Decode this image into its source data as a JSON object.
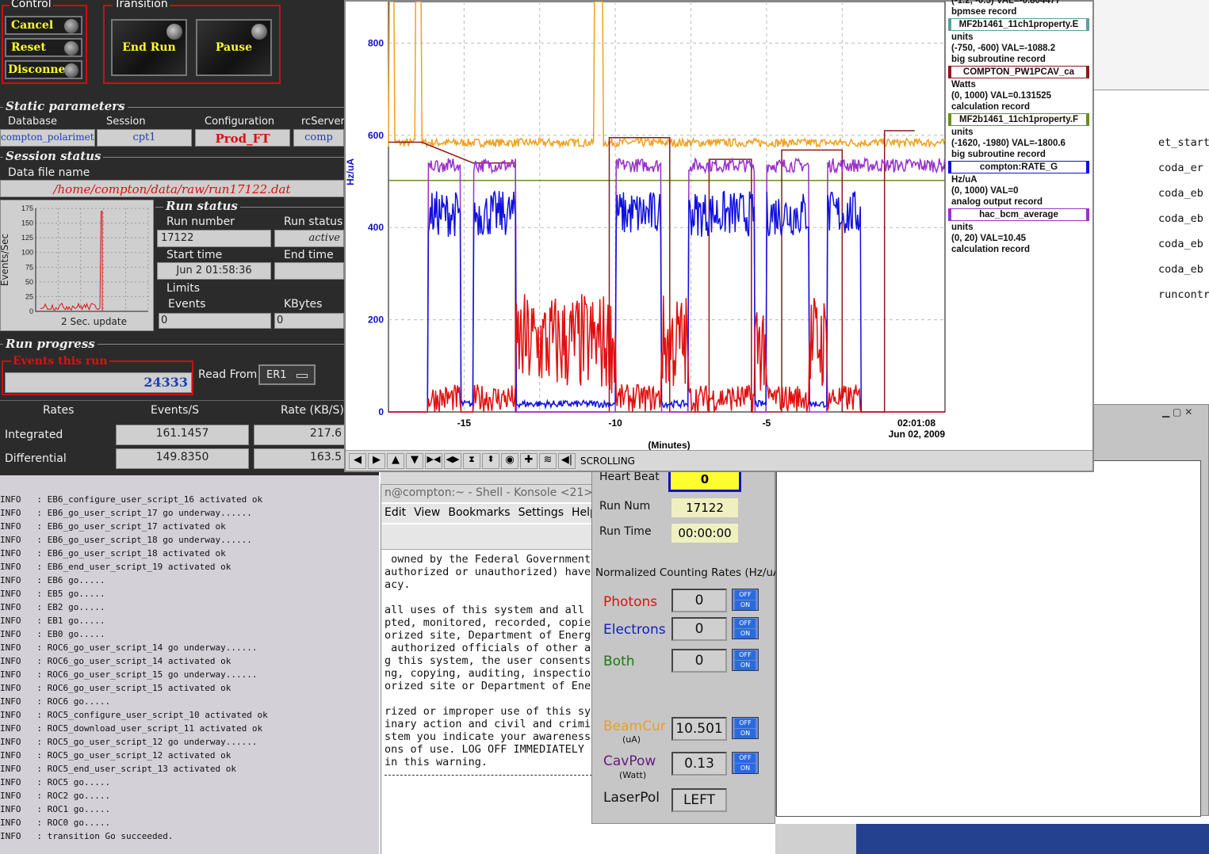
{
  "rc": {
    "control_title": "Control",
    "transition_title": "Transition",
    "cancel": "Cancel",
    "reset": "Reset",
    "disconnect": "Disconnect",
    "end_run": "End Run",
    "pause": "Pause",
    "static_params": "Static parameters",
    "database_lbl": "Database",
    "session_lbl": "Session",
    "config_lbl": "Configuration",
    "rcserver_lbl": "rcServer",
    "database_val": "compton_polarimeter",
    "session_val": "cpt1",
    "config_val": "Prod_FT",
    "rcserver_val": "comp",
    "session_status": "Session status",
    "datafile_lbl": "Data file name",
    "datafile_val": "/home/compton/data/raw/run17122.dat",
    "plot_ylabel": "Events/Sec",
    "plot_update": "2 Sec. update",
    "plot_yticks": [
      "175",
      "150",
      "125",
      "100",
      "75",
      "50",
      "25",
      "0"
    ],
    "run_status_title": "Run status",
    "run_number_lbl": "Run number",
    "run_status_lbl": "Run status",
    "run_number_val": "17122",
    "run_status_val": "active",
    "start_time_lbl": "Start time",
    "end_time_lbl": "End time",
    "start_time_val": "Jun 2 01:58:36",
    "limits_lbl": "Limits",
    "events_lbl": "Events",
    "kbytes_lbl": "KBytes",
    "events_limit": "0",
    "kbytes_limit": "0",
    "run_progress": "Run progress",
    "events_this_run_lbl": "Events this run",
    "events_this_run_val": "24333",
    "read_from_lbl": "Read From:",
    "read_from_val": "ER1",
    "rates_hdr": "Rates",
    "events_s_hdr": "Events/S",
    "rate_kb_hdr": "Rate (KB/S)",
    "integrated_lbl": "Integrated",
    "differential_lbl": "Differential",
    "integrated_ev": "161.1457",
    "integrated_kb": "217.6",
    "differential_ev": "149.8350",
    "differential_kb": "163.5"
  },
  "log": [
    "INFO   : EB6_configure_user_script_16 activated ok",
    "INFO   : EB6_go_user_script_17 go underway......",
    "INFO   : EB6_go_user_script_17 activated ok",
    "INFO   : EB6_go_user_script_18 go underway......",
    "INFO   : EB6_go_user_script_18 activated ok",
    "INFO   : EB6_end_user_script_19 activated ok",
    "INFO   : EB6 go.....",
    "INFO   : EB5 go.....",
    "INFO   : EB2 go.....",
    "INFO   : EB1 go.....",
    "INFO   : EB0 go.....",
    "INFO   : ROC6_go_user_script_14 go underway......",
    "INFO   : ROC6_go_user_script_14 activated ok",
    "INFO   : ROC6_go_user_script_15 go underway......",
    "INFO   : ROC6_go_user_script_15 activated ok",
    "INFO   : ROC6 go.....",
    "INFO   : ROC5_configure_user_script_10 activated ok",
    "INFO   : ROC5_download_user_script_11 activated ok",
    "INFO   : ROC5_go_user_script_12 go underway......",
    "INFO   : ROC5_go_user_script_12 activated ok",
    "INFO   : ROC5_end_user_script_13 activated ok",
    "INFO   : ROC5 go.....",
    "INFO   : ROC2 go.....",
    "INFO   : ROC1 go.....",
    "INFO   : ROC0 go.....",
    "INFO   : transition Go succeeded."
  ],
  "strip": {
    "ylabel": "Hz/uA",
    "xlabel": "(Minutes)",
    "time": "02:01:08",
    "date": "Jun 02, 2009",
    "mode": "SCROLLING",
    "yticks": [
      "800",
      "600",
      "400",
      "200",
      "0"
    ],
    "xticks": [
      "-15",
      "-10",
      "-5"
    ],
    "legend": [
      {
        "name": "",
        "range": "(-1.2, -0.5) VAL=-0.804477",
        "type": "bpmsee record",
        "color": "#ffffff"
      },
      {
        "name": "MF2b1461_11ch1property.E",
        "units": "units",
        "range": "(-750, -600) VAL=-1088.2",
        "type": "big subroutine record",
        "color": "#5aa0a0"
      },
      {
        "name": "COMPTON_PW1PCAV_ca",
        "units": "Watts",
        "range": "(0, 1000) VAL=0.131525",
        "type": "calculation record",
        "color": "#8b1a1a"
      },
      {
        "name": "MF2b1461_11ch1property.F",
        "units": "units",
        "range": "(-1620, -1980) VAL=-1800.6",
        "type": "big subroutine record",
        "color": "#6b8e23"
      },
      {
        "name": "compton:RATE_G",
        "units": "Hz/uA",
        "range": "(0, 1000) VAL=0",
        "type": "analog output record",
        "color": "#1010e0"
      },
      {
        "name": "hac_bcm_average",
        "units": "units",
        "range": "(0, 20) VAL=10.45",
        "type": "calculation record",
        "color": "#9932cc"
      }
    ]
  },
  "konsole": {
    "title": "n@compton:~ - Shell - Konsole <21>",
    "menu": [
      "Edit",
      "View",
      "Bookmarks",
      "Settings",
      "Help"
    ],
    "lines": [
      " owned by the Federal Government.",
      "authorized or unauthorized) have",
      "acy.",
      "",
      "all uses of this system and all f",
      "pted, monitored, recorded, copied",
      "orized site, Department of Energy",
      " authorized officials of other ag",
      "g this system, the user consents",
      "ng, copying, auditing, inspection",
      "orized site or Department of Ener",
      "",
      "rized or improper use of this sys",
      "inary action and civil and crimin",
      "stem you indicate your awareness",
      "ons of use. LOG OFF IMMEDIATELY i",
      "in this warning."
    ]
  },
  "edm": {
    "heartbeat_lbl": "Heart Beat",
    "heartbeat_val": "0",
    "runnum_lbl": "Run Num",
    "runnum_val": "17122",
    "runtime_lbl": "Run Time",
    "runtime_val": "00:00:00",
    "norm_lbl": "Normalized Counting Rates (Hz/uA)",
    "photons_lbl": "Photons",
    "photons_val": "0",
    "electrons_lbl": "Electrons",
    "electrons_val": "0",
    "both_lbl": "Both",
    "both_val": "0",
    "beamcur_lbl": "BeamCur",
    "beamcur_unit": "(uA)",
    "beamcur_val": "10.501",
    "cavpow_lbl": "CavPow",
    "cavpow_unit": "(Watt)",
    "cavpow_val": "0.13",
    "laserpol_lbl": "LaserPol",
    "laserpol_val": "LEFT",
    "off": "OFF",
    "on": "ON"
  },
  "right_terms": [
    "et_start",
    "coda_er",
    "coda_eb",
    "coda_eb",
    "coda_eb",
    "coda_eb",
    "runcontr"
  ]
}
